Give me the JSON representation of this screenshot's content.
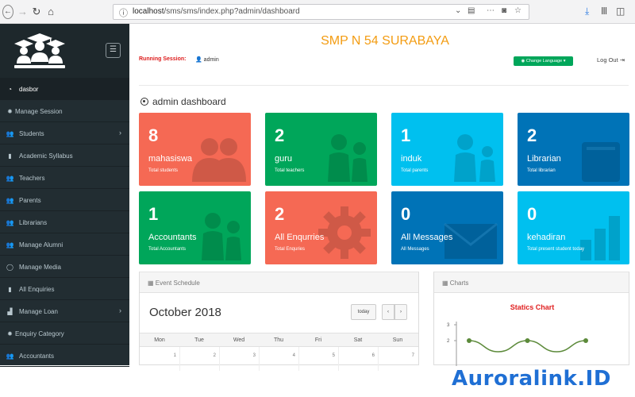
{
  "browser": {
    "url_host": "localhost",
    "url_path": "/sms/sms/index.php?admin/dashboard"
  },
  "sidebar": {
    "items": [
      {
        "label": "dasbor",
        "icon": "dashboard-icon"
      },
      {
        "label": "Manage Session",
        "icon": "gear-icon"
      },
      {
        "label": "Students",
        "icon": "users-icon",
        "has_submenu": true
      },
      {
        "label": "Academic Syllabus",
        "icon": "book-icon"
      },
      {
        "label": "Teachers",
        "icon": "users-icon"
      },
      {
        "label": "Parents",
        "icon": "users-icon"
      },
      {
        "label": "Librarians",
        "icon": "users-icon"
      },
      {
        "label": "Manage Alumni",
        "icon": "users-icon"
      },
      {
        "label": "Manage Media",
        "icon": "circle-icon"
      },
      {
        "label": "All Enquiries",
        "icon": "book-icon"
      },
      {
        "label": "Manage Loan",
        "icon": "bar-chart-icon",
        "has_submenu": true
      },
      {
        "label": "Enquiry Category",
        "icon": "gear-icon"
      },
      {
        "label": "Accountants",
        "icon": "users-icon"
      }
    ]
  },
  "header": {
    "school_name": "SMP N 54 SURABAYA",
    "running_session_label": "Running Session:",
    "user": "admin",
    "change_language": "Change Language",
    "logout": "Log Out"
  },
  "dashboard": {
    "title": "admin dashboard",
    "stats": [
      {
        "number": "8",
        "label": "mahasiswa",
        "sub": "Total students",
        "color": "#f56954",
        "icon": "users-icon"
      },
      {
        "number": "2",
        "label": "guru",
        "sub": "Total teachers",
        "color": "#00a65a",
        "icon": "teacher-icon"
      },
      {
        "number": "1",
        "label": "induk",
        "sub": "Total parents",
        "color": "#00c0ef",
        "icon": "parent-icon"
      },
      {
        "number": "2",
        "label": "Librarian",
        "sub": "Total librarian",
        "color": "#0073b7",
        "icon": "book-icon"
      },
      {
        "number": "1",
        "label": "Accountants",
        "sub": "Total Accountants",
        "color": "#00a65a",
        "icon": "teacher-icon"
      },
      {
        "number": "2",
        "label": "All Enqurries",
        "sub": "Total Enquries",
        "color": "#f56954",
        "icon": "gear-icon"
      },
      {
        "number": "0",
        "label": "All Messages",
        "sub": "All Messages",
        "color": "#0073b7",
        "icon": "envelope-icon"
      },
      {
        "number": "0",
        "label": "kehadiran",
        "sub": "Total present student today",
        "color": "#00c0ef",
        "icon": "bar-chart-icon"
      }
    ]
  },
  "calendar": {
    "panel_title": "Event Schedule",
    "month": "October 2018",
    "today_label": "today",
    "prev_label": "‹",
    "next_label": "›",
    "days": [
      "Mon",
      "Tue",
      "Wed",
      "Thu",
      "Fri",
      "Sat",
      "Sun"
    ],
    "first_row": [
      "1",
      "2",
      "3",
      "4",
      "5",
      "6",
      "7"
    ]
  },
  "charts": {
    "panel_title": "Charts"
  },
  "chart_data": {
    "type": "line",
    "title": "Statics Chart",
    "xlabel": "",
    "ylabel": "",
    "y_ticks": [
      "3",
      "2"
    ],
    "ylim": [
      0,
      3
    ],
    "series": [
      {
        "values": [
          2,
          1.3,
          2,
          1.3,
          2
        ],
        "color": "#5c8a3a"
      }
    ]
  },
  "watermark": "Auroralink.ID"
}
